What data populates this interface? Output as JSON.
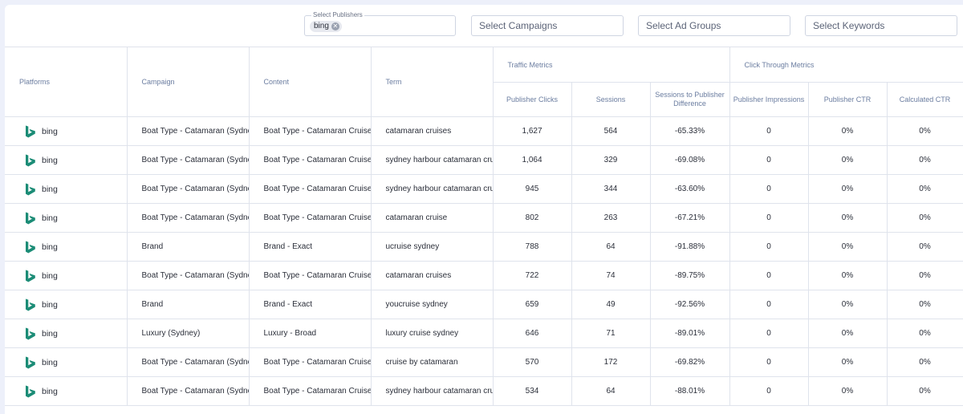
{
  "filters": {
    "publishers_label": "Select Publishers",
    "publisher_chip": "bing",
    "campaigns_placeholder": "Select Campaigns",
    "ad_groups_placeholder": "Select Ad Groups",
    "keywords_placeholder": "Select Keywords"
  },
  "table": {
    "headers": {
      "platforms": "Platforms",
      "campaign": "Campaign",
      "content": "Content",
      "term": "Term",
      "traffic_group": "Traffic Metrics",
      "ctr_group": "Click Through Metrics",
      "publisher_clicks": "Publisher Clicks",
      "sessions": "Sessions",
      "difference": "Sessions to Publisher Difference",
      "impressions": "Publisher Impressions",
      "publisher_ctr": "Publisher CTR",
      "calculated_ctr": "Calculated CTR"
    },
    "logo_icon": "bing-logo-icon",
    "brand_color": "#1b8c76",
    "rows": [
      {
        "platform": "bing",
        "campaign": "Boat Type - Catamaran (Sydney)",
        "content": "Boat Type - Catamaran Cruises",
        "term": "catamaran cruises",
        "clicks": "1,627",
        "sessions": "564",
        "difference": "-65.33%",
        "impressions": "0",
        "publisher_ctr": "0%",
        "calculated_ctr": "0%"
      },
      {
        "platform": "bing",
        "campaign": "Boat Type - Catamaran (Sydney)",
        "content": "Boat Type - Catamaran Cruises",
        "term": "sydney harbour catamaran cruise",
        "clicks": "1,064",
        "sessions": "329",
        "difference": "-69.08%",
        "impressions": "0",
        "publisher_ctr": "0%",
        "calculated_ctr": "0%"
      },
      {
        "platform": "bing",
        "campaign": "Boat Type - Catamaran (Sydney)",
        "content": "Boat Type - Catamaran Cruises",
        "term": "sydney harbour catamaran cruise",
        "clicks": "945",
        "sessions": "344",
        "difference": "-63.60%",
        "impressions": "0",
        "publisher_ctr": "0%",
        "calculated_ctr": "0%"
      },
      {
        "platform": "bing",
        "campaign": "Boat Type - Catamaran (Sydney)",
        "content": "Boat Type - Catamaran Cruises",
        "term": "catamaran cruise",
        "clicks": "802",
        "sessions": "263",
        "difference": "-67.21%",
        "impressions": "0",
        "publisher_ctr": "0%",
        "calculated_ctr": "0%"
      },
      {
        "platform": "bing",
        "campaign": "Brand",
        "content": "Brand - Exact",
        "term": "ucruise sydney",
        "clicks": "788",
        "sessions": "64",
        "difference": "-91.88%",
        "impressions": "0",
        "publisher_ctr": "0%",
        "calculated_ctr": "0%"
      },
      {
        "platform": "bing",
        "campaign": "Boat Type - Catamaran (Sydney)",
        "content": "Boat Type - Catamaran Cruises",
        "term": "catamaran cruises",
        "clicks": "722",
        "sessions": "74",
        "difference": "-89.75%",
        "impressions": "0",
        "publisher_ctr": "0%",
        "calculated_ctr": "0%"
      },
      {
        "platform": "bing",
        "campaign": "Brand",
        "content": "Brand - Exact",
        "term": "youcruise sydney",
        "clicks": "659",
        "sessions": "49",
        "difference": "-92.56%",
        "impressions": "0",
        "publisher_ctr": "0%",
        "calculated_ctr": "0%"
      },
      {
        "platform": "bing",
        "campaign": "Luxury (Sydney)",
        "content": "Luxury - Broad",
        "term": "luxury cruise sydney",
        "clicks": "646",
        "sessions": "71",
        "difference": "-89.01%",
        "impressions": "0",
        "publisher_ctr": "0%",
        "calculated_ctr": "0%"
      },
      {
        "platform": "bing",
        "campaign": "Boat Type - Catamaran (Sydney)",
        "content": "Boat Type - Catamaran Cruises",
        "term": "cruise by catamaran",
        "clicks": "570",
        "sessions": "172",
        "difference": "-69.82%",
        "impressions": "0",
        "publisher_ctr": "0%",
        "calculated_ctr": "0%"
      },
      {
        "platform": "bing",
        "campaign": "Boat Type - Catamaran (Sydney)",
        "content": "Boat Type - Catamaran Cruises",
        "term": "sydney harbour catamaran cruise",
        "clicks": "534",
        "sessions": "64",
        "difference": "-88.01%",
        "impressions": "0",
        "publisher_ctr": "0%",
        "calculated_ctr": "0%"
      }
    ]
  }
}
